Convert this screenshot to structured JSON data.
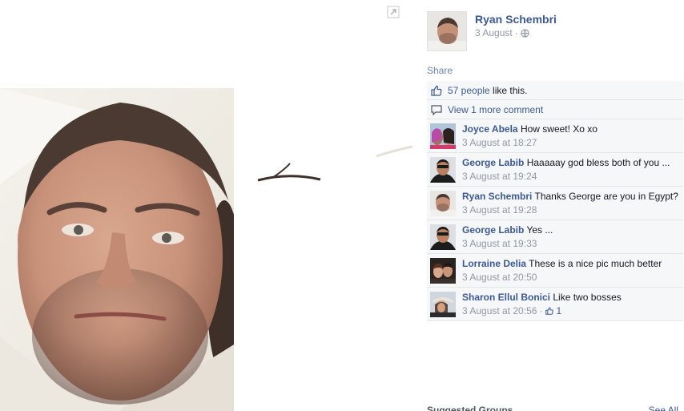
{
  "post": {
    "author": "Ryan Schembri",
    "date": "3 August",
    "separator": "·",
    "share": "Share"
  },
  "likes": {
    "count_text": "57 people",
    "suffix": " like this."
  },
  "more_comments": "View 1 more comment",
  "comments": [
    {
      "name": "Joyce Abela",
      "text": "How sweet! Xo xo",
      "time": "3 August at 18:27"
    },
    {
      "name": "George Labib",
      "text": "Haaaaay god bless both of you ...",
      "time": "3 August at 19:24"
    },
    {
      "name": "Ryan Schembri",
      "text": "Thanks George are you in Egypt?",
      "time": "3 August at 19:28"
    },
    {
      "name": "George Labib",
      "text": "Yes ...",
      "time": "3 August at 19:33"
    },
    {
      "name": "Lorraine Delia",
      "text": "These is a nice pic much better",
      "time": "3 August at 20:50"
    },
    {
      "name": "Sharon Ellul Bonici",
      "text": "Like two bosses",
      "time": "3 August at 20:56",
      "separator": "·",
      "likes": "1"
    }
  ],
  "suggested": {
    "title": "Suggested Groups",
    "see_all": "See All"
  },
  "colors": {
    "link": "#3b5998",
    "meta": "#9197a3",
    "ufi_bg": "#f6f7f9"
  },
  "icons": [
    "expand-icon",
    "globe-icon",
    "thumbs-up-icon",
    "comment-icon"
  ]
}
